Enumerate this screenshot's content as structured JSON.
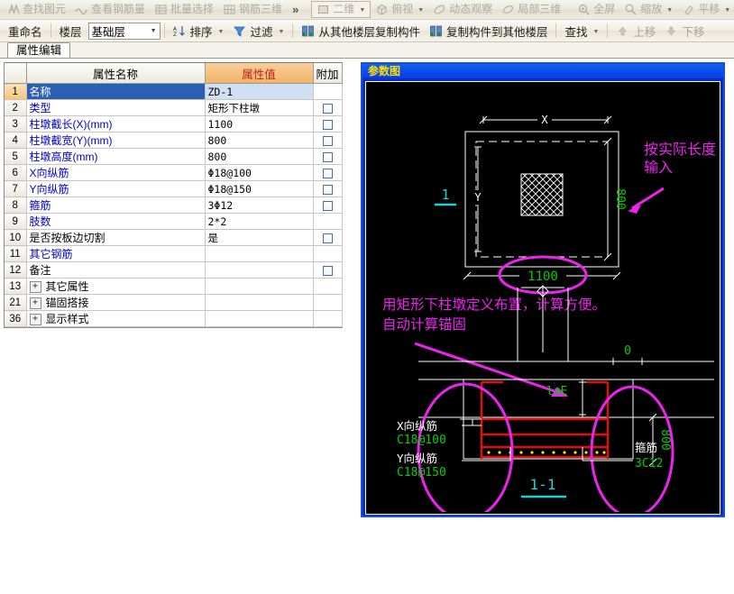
{
  "toolbar_top": {
    "items": [
      {
        "label": "查找图元",
        "icon": "find-element-icon"
      },
      {
        "label": "查看钢筋量",
        "icon": "view-rebar-quantity-icon"
      },
      {
        "label": "批量选择",
        "icon": "batch-select-icon"
      },
      {
        "label": "钢筋三维",
        "icon": "rebar-3d-icon"
      }
    ],
    "overflow": "»",
    "view_items": [
      {
        "label": "二维",
        "icon": "two-d-icon",
        "has_caret": true,
        "active": true
      },
      {
        "label": "俯视",
        "icon": "top-view-icon",
        "has_caret": true
      },
      {
        "label": "动态观察",
        "icon": "dynamic-observe-icon",
        "has_caret": false
      },
      {
        "label": "局部三维",
        "icon": "local-3d-icon",
        "has_caret": false
      },
      {
        "label": "全屏",
        "icon": "fullscreen-icon",
        "has_caret": false
      },
      {
        "label": "缩放",
        "icon": "zoom-icon",
        "has_caret": true
      },
      {
        "label": "平移",
        "icon": "pan-icon",
        "has_caret": true
      }
    ]
  },
  "toolbar_second": {
    "rename_label": "重命名",
    "floor_label": "楼层",
    "floor_value": "基础层",
    "sort_label": "排序",
    "filter_label": "过滤",
    "copy_from_label": "从其他楼层复制构件",
    "copy_to_label": "复制构件到其他楼层",
    "search_label": "查找",
    "move_up_label": "上移",
    "move_down_label": "下移"
  },
  "tab": {
    "label": "属性编辑"
  },
  "grid": {
    "headers": {
      "index": "",
      "name": "属性名称",
      "value": "属性值",
      "append": "附加"
    },
    "rows": [
      {
        "idx": "1",
        "name": "名称",
        "value": "ZD-1",
        "check": false,
        "selected": true,
        "blackLabel": false,
        "group": false
      },
      {
        "idx": "2",
        "name": "类型",
        "value": "矩形下柱墩",
        "check": true,
        "selected": false,
        "blackLabel": false,
        "group": false
      },
      {
        "idx": "3",
        "name": "柱墩截长(X)(mm)",
        "value": "1100",
        "check": true,
        "selected": false,
        "blackLabel": false,
        "group": false
      },
      {
        "idx": "4",
        "name": "柱墩截宽(Y)(mm)",
        "value": "800",
        "check": true,
        "selected": false,
        "blackLabel": false,
        "group": false
      },
      {
        "idx": "5",
        "name": "柱墩高度(mm)",
        "value": "800",
        "check": true,
        "selected": false,
        "blackLabel": false,
        "group": false
      },
      {
        "idx": "6",
        "name": "X向纵筋",
        "value": "Φ18@100",
        "check": true,
        "selected": false,
        "blackLabel": false,
        "group": false
      },
      {
        "idx": "7",
        "name": "Y向纵筋",
        "value": "Φ18@150",
        "check": true,
        "selected": false,
        "blackLabel": false,
        "group": false
      },
      {
        "idx": "8",
        "name": "箍筋",
        "value": "3Φ12",
        "check": true,
        "selected": false,
        "blackLabel": false,
        "group": false
      },
      {
        "idx": "9",
        "name": "肢数",
        "value": "2*2",
        "check": false,
        "selected": false,
        "blackLabel": false,
        "group": false
      },
      {
        "idx": "10",
        "name": "是否按板边切割",
        "value": "是",
        "check": true,
        "selected": false,
        "blackLabel": true,
        "group": false
      },
      {
        "idx": "11",
        "name": "其它钢筋",
        "value": "",
        "check": false,
        "selected": false,
        "blackLabel": false,
        "group": false
      },
      {
        "idx": "12",
        "name": "备注",
        "value": "",
        "check": true,
        "selected": false,
        "blackLabel": true,
        "group": false
      },
      {
        "idx": "13",
        "name": "其它属性",
        "value": "",
        "check": false,
        "selected": false,
        "blackLabel": true,
        "group": true
      },
      {
        "idx": "21",
        "name": "锚固搭接",
        "value": "",
        "check": false,
        "selected": false,
        "blackLabel": true,
        "group": true
      },
      {
        "idx": "36",
        "name": "显示样式",
        "value": "",
        "check": false,
        "selected": false,
        "blackLabel": true,
        "group": true
      }
    ]
  },
  "panel": {
    "title": "参数图",
    "plan": {
      "dim_x_label": "X",
      "dim_y_label": "Y",
      "section_mark": "1",
      "section_mark_bottom": "1",
      "width_value": "1100",
      "height_value": "800"
    },
    "section": {
      "label": "1-1",
      "anchor_label": "laE",
      "zero_label": "0",
      "depth_value": "800",
      "x_rebar_label": "X向纵筋",
      "x_rebar_value": "C18@100",
      "y_rebar_label": "Y向纵筋",
      "y_rebar_value": "C18@150",
      "stirrup_label": "箍筋",
      "stirrup_value": "3C12"
    },
    "annotations": {
      "top_line1": "按实际长度",
      "top_line2": "输入",
      "mid_line1": "用矩形下柱墩定义布置，计算方便。",
      "mid_line2": "自动计算锚固"
    }
  },
  "colors": {
    "accent_blue": "#2a5fb4",
    "value_header": "#f0b468",
    "value_header_text": "#c21f1f",
    "name_text": "#0000cd",
    "magenta": "#ee22ee",
    "green": "#00d000",
    "cyan": "#15d6d6",
    "rebar_red": "#e01010",
    "panel_blue": "#0a2fc0"
  }
}
